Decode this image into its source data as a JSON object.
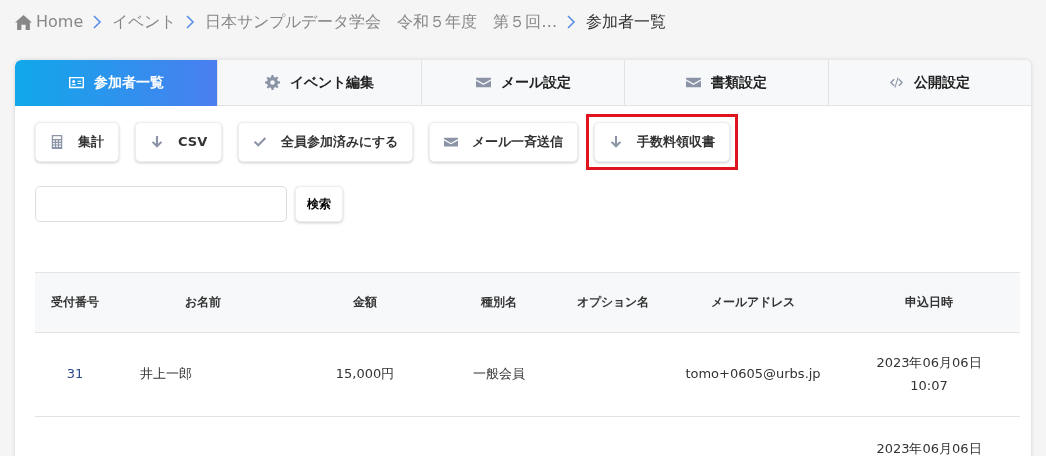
{
  "breadcrumb": [
    {
      "kind": "home",
      "label": "Home"
    },
    {
      "kind": "link",
      "label": "イベント"
    },
    {
      "kind": "link",
      "label": "日本サンプルデータ学会　令和５年度　第５回…"
    },
    {
      "kind": "current",
      "label": "参加者一覧"
    }
  ],
  "tabs": [
    {
      "kind": "card",
      "label": "参加者一覧",
      "selected": true
    },
    {
      "kind": "gear",
      "label": "イベント編集",
      "selected": false
    },
    {
      "kind": "mail",
      "label": "メール設定",
      "selected": false
    },
    {
      "kind": "mail",
      "label": "書類設定",
      "selected": false
    },
    {
      "kind": "code",
      "label": "公開設定",
      "selected": false
    }
  ],
  "actions": [
    {
      "kind": "calc",
      "label": "集計",
      "highlighted": false
    },
    {
      "kind": "down",
      "label": "CSV",
      "highlighted": false
    },
    {
      "kind": "check",
      "label": "全員参加済みにする",
      "highlighted": false
    },
    {
      "kind": "mail",
      "label": "メール一斉送信",
      "highlighted": false
    },
    {
      "kind": "down",
      "label": "手数料領収書",
      "highlighted": true
    }
  ],
  "search": {
    "button": "検索"
  },
  "table": {
    "columns": [
      "受付番号",
      "お名前",
      "金額",
      "種別名",
      "オプション名",
      "メールアドレス",
      "申込日時"
    ],
    "rows": [
      {
        "number": "31",
        "name": "井上一郎",
        "amount": "15,000円",
        "type": "一般会員",
        "email": "tomo+0605@urbs.jp",
        "date": "2023年06月06日",
        "time": "10:07"
      },
      {
        "date": "2023年06月06日"
      }
    ]
  }
}
